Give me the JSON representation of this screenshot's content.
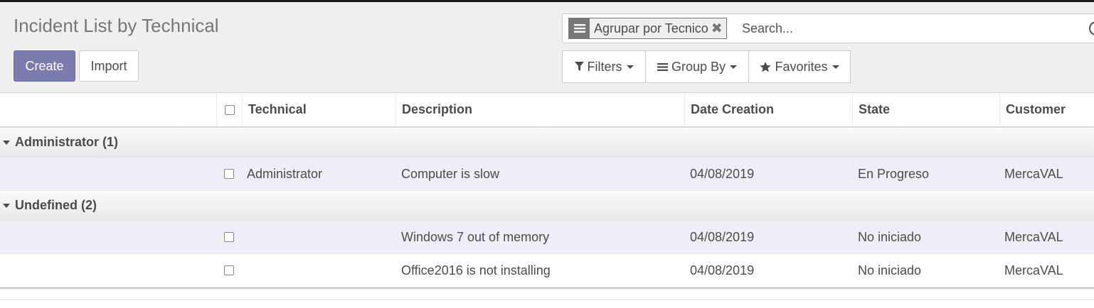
{
  "page_title": "Incident List by Technical",
  "buttons": {
    "create": "Create",
    "import": "Import"
  },
  "search": {
    "facet_icon": "list-icon",
    "facet_value": "Agrupar por Tecnico",
    "facet_remove": "✖",
    "placeholder": "Search..."
  },
  "search_buttons": {
    "filters": "Filters",
    "group_by": "Group By",
    "favorites": "Favorites"
  },
  "table": {
    "columns": [
      "Technical",
      "Description",
      "Date Creation",
      "State",
      "Customer"
    ],
    "groups": [
      {
        "label": "Administrator (1)",
        "rows": [
          {
            "technical": "Administrator",
            "description": "Computer is slow",
            "date": "04/08/2019",
            "state": "En Progreso",
            "customer": "MercaVAL"
          }
        ]
      },
      {
        "label": "Undefined (2)",
        "rows": [
          {
            "technical": "",
            "description": "Windows 7 out of memory",
            "date": "04/08/2019",
            "state": "No iniciado",
            "customer": "MercaVAL"
          },
          {
            "technical": "",
            "description": "Office2016 is not installing",
            "date": "04/08/2019",
            "state": "No iniciado",
            "customer": "MercaVAL"
          }
        ]
      }
    ]
  },
  "colors": {
    "primary": "#7c7bad",
    "panel_bg": "#f0eeee",
    "row_shade": "#eeeef6"
  }
}
